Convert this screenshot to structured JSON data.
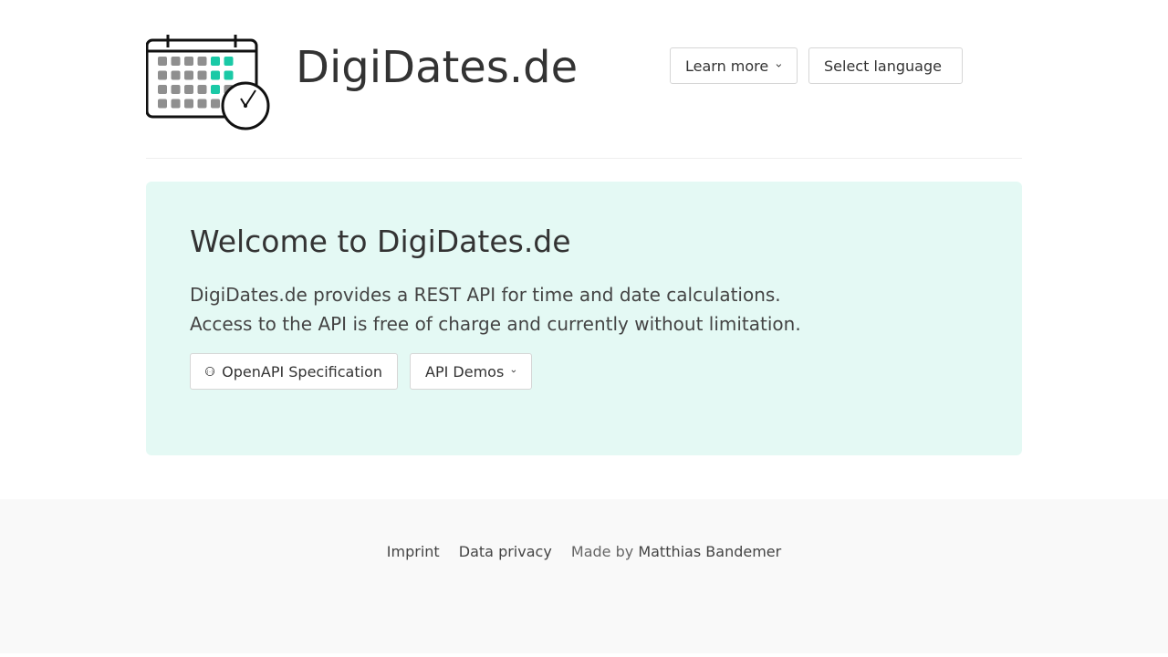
{
  "header": {
    "site_title": "DigiDates.de",
    "learn_more_label": "Learn more",
    "select_language_label": "Select language",
    "logo_icon": "calendar-clock-icon"
  },
  "hero": {
    "title": "Welcome to DigiDates.de",
    "text_line1": "DigiDates.de provides a REST API for time and date calculations.",
    "text_line2": "Access to the API is free of charge and currently without limitation.",
    "openapi_label": "OpenAPI Specification",
    "api_demos_label": "API Demos"
  },
  "footer": {
    "imprint": "Imprint",
    "data_privacy": "Data privacy",
    "made_by": "Made by",
    "author": "Matthias Bandemer"
  },
  "colors": {
    "accent": "#1ac9a6",
    "hero_bg": "#e4f9f4",
    "footer_bg": "#f9f9f9"
  }
}
